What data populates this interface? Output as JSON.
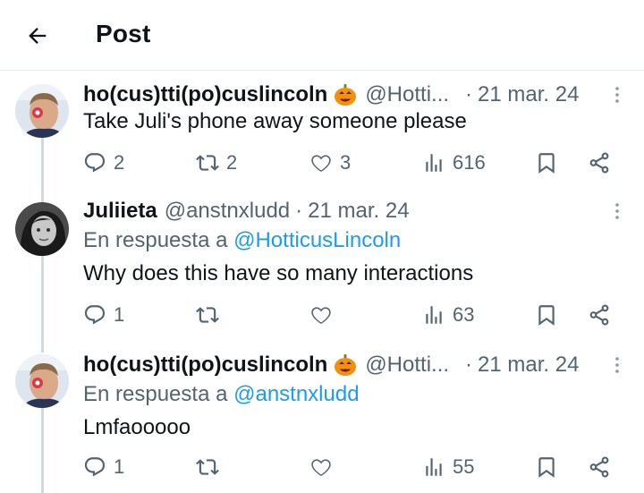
{
  "header": {
    "title": "Post"
  },
  "tweets": [
    {
      "display_name": "ho(cus)tti(po)cuslincoln",
      "emoji": "pumpkin-emoji",
      "handle": "@Hotti...",
      "sep": "·",
      "date": "21 mar. 24",
      "reply_prefix": "",
      "reply_to": "",
      "text": "Take Juli's phone away someone please",
      "replies": "2",
      "reposts": "2",
      "likes": "3",
      "views": "616"
    },
    {
      "display_name": "Juliieta",
      "emoji": "",
      "handle": "@anstnxludd",
      "sep": "·",
      "date": "21 mar. 24",
      "reply_prefix": "En respuesta a ",
      "reply_to": "@HotticusLincoln",
      "text": "Why does this have so many interactions",
      "replies": "1",
      "reposts": "",
      "likes": "",
      "views": "63"
    },
    {
      "display_name": "ho(cus)tti(po)cuslincoln",
      "emoji": "pumpkin-emoji",
      "handle": "@Hotti...",
      "sep": "·",
      "date": "21 mar. 24",
      "reply_prefix": "En respuesta a ",
      "reply_to": "@anstnxludd",
      "text": "Lmfaooooo",
      "replies": "1",
      "reposts": "",
      "likes": "",
      "views": "55"
    }
  ],
  "colors": {
    "text": "#0f1419",
    "muted": "#536471",
    "link": "#1d9bf0",
    "thread_line": "#cfd9de",
    "pumpkin": "#f4900c"
  }
}
